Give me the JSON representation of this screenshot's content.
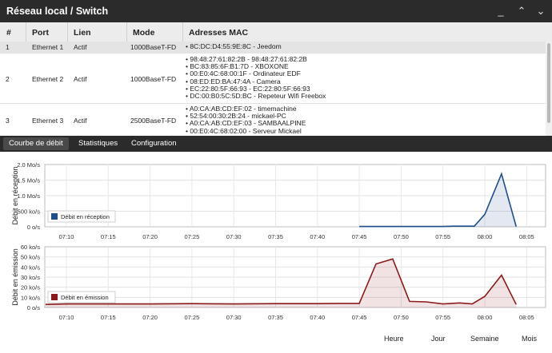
{
  "window": {
    "title": "Réseau local / Switch",
    "min": "_",
    "restore": "⌃",
    "max": "⌄",
    "close": "✕"
  },
  "table": {
    "headers": {
      "num": "#",
      "port": "Port",
      "lien": "Lien",
      "mode": "Mode",
      "mac": "Adresses MAC"
    },
    "rows": [
      {
        "num": "1",
        "port": "Ethernet 1",
        "lien": "Actif",
        "mode": "1000BaseT-FD",
        "macs": [
          "8C:DC:D4:55:9E:8C - Jeedom"
        ]
      },
      {
        "num": "2",
        "port": "Ethernet 2",
        "lien": "Actif",
        "mode": "1000BaseT-FD",
        "macs": [
          "98:48:27:61:82:2B - 98:48:27:61:82:2B",
          "BC:83:85:6F:B1:7D - XBOXONE",
          "00:E0:4C:68:00:1F - Ordinateur EDF",
          "08:ED:ED:BA:47:4A - Camera",
          "EC:22:80:5F:66:93 - EC:22:80:5F:66:93",
          "DC:00:B0:5C:5D:BC - Repeteur Wifi Freebox"
        ]
      },
      {
        "num": "3",
        "port": "Ethernet 3",
        "lien": "Actif",
        "mode": "2500BaseT-FD",
        "macs": [
          "A0:CA:AB:CD:EF:02 - timemachine",
          "52:54:00:30:2B:24 - mickael-PC",
          "A0:CA:AB:CD:EF:03 - SAMBAALPINE",
          "00:E0:4C:68:02:00 - Serveur Mickael"
        ]
      }
    ]
  },
  "tabs": [
    "Courbe de débit",
    "Statistiques",
    "Configuration"
  ],
  "period_buttons": [
    "Heure",
    "Jour",
    "Semaine",
    "Mois"
  ],
  "colors": {
    "rx": "#1f4e8c",
    "tx": "#8b1a1a",
    "titlebar": "#2b2b2b"
  },
  "chart_data": [
    {
      "type": "area",
      "ylabel": "Débit en réception",
      "yticks": [
        "0 o/s",
        "500 ko/s",
        "1.0 Mo/s",
        "1.5 Mo/s",
        "2.0 Mo/s"
      ],
      "ylim": [
        0,
        2.0
      ],
      "x_ticks": [
        "07:10",
        "07:15",
        "07:20",
        "07:25",
        "07:30",
        "07:35",
        "07:40",
        "07:45",
        "07:50",
        "07:55",
        "08:00",
        "08:05"
      ],
      "series": [
        {
          "name": "Débit en réception",
          "color": "#1f4e8c",
          "x": [
            7.0,
            7.5,
            7.75,
            8.0,
            8.75,
            9.0,
            9.25,
            9.75,
            10.0,
            10.4,
            10.75
          ],
          "values": [
            0.01,
            0.01,
            0.01,
            0.01,
            0.01,
            0.01,
            0.02,
            0.02,
            0.4,
            1.7,
            0.01
          ]
        }
      ],
      "grid": true,
      "legend": "bottom-left"
    },
    {
      "type": "area",
      "ylabel": "Débit en émission",
      "yticks": [
        "0 o/s",
        "10 ko/s",
        "20 ko/s",
        "30 ko/s",
        "40 ko/s",
        "50 ko/s",
        "60 ko/s"
      ],
      "ylim": [
        0,
        60
      ],
      "x_ticks": [
        "07:10",
        "07:15",
        "07:20",
        "07:25",
        "07:30",
        "07:35",
        "07:40",
        "07:45",
        "07:50",
        "07:55",
        "08:00",
        "08:05"
      ],
      "series": [
        {
          "name": "Débit en émission",
          "color": "#8b1a1a",
          "x": [
            -0.5,
            0,
            1,
            2,
            3,
            4,
            5,
            6,
            6.5,
            7.0,
            7.4,
            7.8,
            8.2,
            8.6,
            9.0,
            9.4,
            9.7,
            10.0,
            10.4,
            10.75
          ],
          "values": [
            3,
            3.5,
            3.5,
            3.5,
            3.8,
            3.5,
            3.8,
            3.8,
            4,
            4,
            43,
            48,
            6,
            5.5,
            3.5,
            4.5,
            3.5,
            11,
            32,
            3
          ]
        }
      ],
      "grid": true,
      "legend": "bottom-left"
    }
  ]
}
